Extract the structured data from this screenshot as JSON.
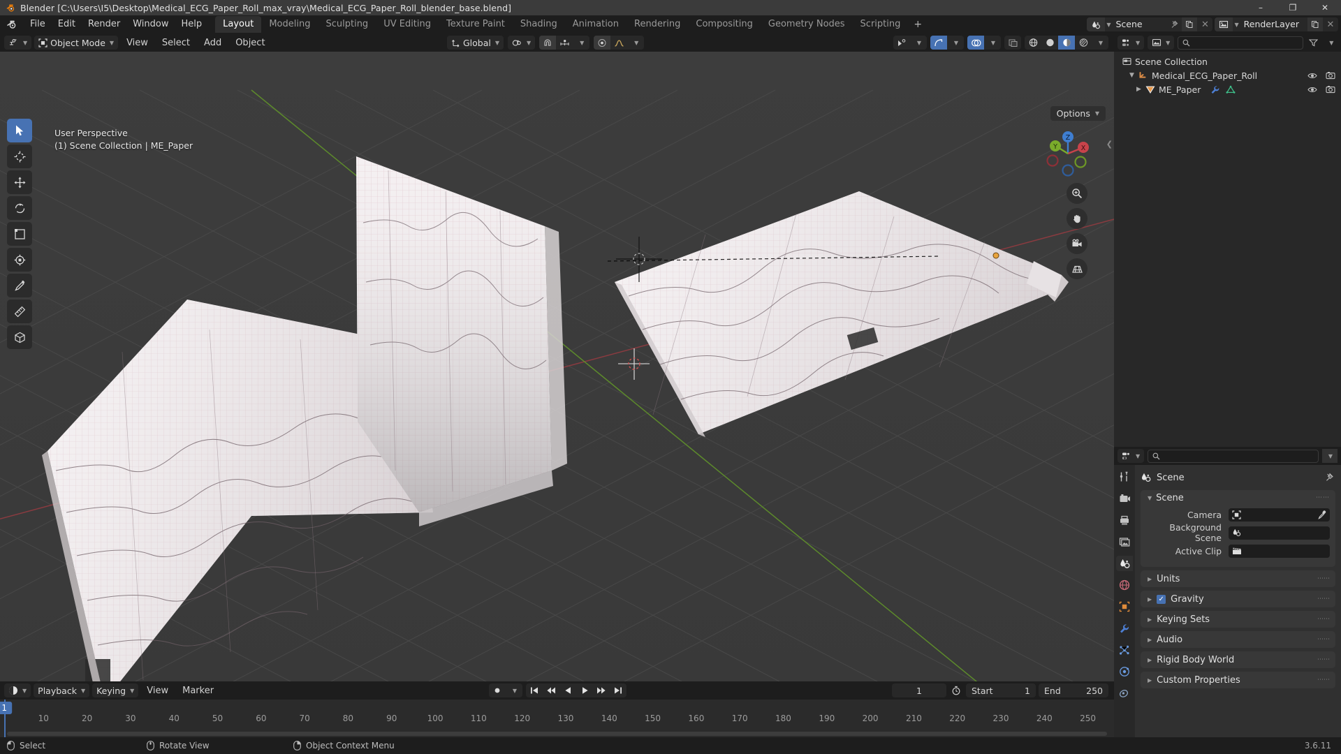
{
  "window": {
    "title": "Blender [C:\\Users\\I5\\Desktop\\Medical_ECG_Paper_Roll_max_vray\\Medical_ECG_Paper_Roll_blender_base.blend]",
    "minimize": "–",
    "maximize": "❐",
    "close": "✕"
  },
  "topbar": {
    "menus": [
      "File",
      "Edit",
      "Render",
      "Window",
      "Help"
    ],
    "workspaces": [
      {
        "label": "Layout",
        "active": true
      },
      {
        "label": "Modeling",
        "active": false
      },
      {
        "label": "Sculpting",
        "active": false
      },
      {
        "label": "UV Editing",
        "active": false
      },
      {
        "label": "Texture Paint",
        "active": false
      },
      {
        "label": "Shading",
        "active": false
      },
      {
        "label": "Animation",
        "active": false
      },
      {
        "label": "Rendering",
        "active": false
      },
      {
        "label": "Compositing",
        "active": false
      },
      {
        "label": "Geometry Nodes",
        "active": false
      },
      {
        "label": "Scripting",
        "active": false
      }
    ],
    "add_workspace": "+",
    "scene_name": "Scene",
    "view_layer_name": "RenderLayer"
  },
  "viewport_header": {
    "editor_type_icon": "editor-type-icon",
    "mode": "Object Mode",
    "menus": [
      "View",
      "Select",
      "Add",
      "Object"
    ],
    "transform_orientation": "Global",
    "snap_icon": "magnet-icon",
    "proportional_icon": "proportional-edit-icon",
    "options_label": "Options"
  },
  "viewport": {
    "perspective_line": "User Perspective",
    "collection_line": "(1) Scene Collection | ME_Paper",
    "gizmo_axes": [
      "Z",
      "Y",
      "X"
    ],
    "tools": [
      {
        "name": "tweak-select-tool",
        "active": true
      },
      {
        "name": "cursor-tool",
        "active": false
      },
      {
        "name": "move-tool",
        "active": false
      },
      {
        "name": "rotate-tool",
        "active": false
      },
      {
        "name": "scale-tool",
        "active": false
      },
      {
        "name": "transform-tool",
        "active": false
      },
      {
        "name": "annotate-tool",
        "active": false
      },
      {
        "name": "measure-tool",
        "active": false
      },
      {
        "name": "add-cube-tool",
        "active": false
      }
    ],
    "nav_buttons": [
      "zoom-icon",
      "pan-hand-icon",
      "camera-view-icon",
      "ortho-persp-icon"
    ]
  },
  "outliner": {
    "display_mode": "view-layer-icon",
    "search_placeholder": "",
    "filter_icon": "filter-icon",
    "rows": [
      {
        "label": "Scene Collection",
        "icon": "collection-icon",
        "indent": 0,
        "expanded": null,
        "eye": false,
        "camera": false
      },
      {
        "label": "Medical_ECG_Paper_Roll",
        "icon": "empty-axes-icon",
        "indent": 1,
        "expanded": true,
        "eye": true,
        "camera": true
      },
      {
        "label": "ME_Paper",
        "icon": "mesh-object-icon",
        "indent": 2,
        "expanded": false,
        "eye": true,
        "camera": true,
        "extras": [
          "wrench-modifier-icon",
          "mesh-data-icon"
        ]
      }
    ]
  },
  "properties": {
    "search_placeholder": "",
    "tabs": [
      {
        "name": "tool-tab",
        "active": false
      },
      {
        "name": "render-tab",
        "active": false
      },
      {
        "name": "output-tab",
        "active": false
      },
      {
        "name": "view-layer-tab",
        "active": false
      },
      {
        "name": "scene-tab",
        "active": true
      },
      {
        "name": "world-tab",
        "active": false
      },
      {
        "name": "object-tab",
        "active": false
      },
      {
        "name": "modifier-tab",
        "active": false
      },
      {
        "name": "particles-tab",
        "active": false
      },
      {
        "name": "physics-tab",
        "active": false
      },
      {
        "name": "constraints-tab",
        "active": false
      }
    ],
    "breadcrumb": "Scene",
    "panel": {
      "title": "Scene",
      "rows": [
        {
          "label": "Camera",
          "value": "",
          "icon": "camera-data-icon",
          "eyedropper": true
        },
        {
          "label": "Background Scene",
          "value": "",
          "icon": "scene-icon",
          "eyedropper": false
        },
        {
          "label": "Active Clip",
          "value": "",
          "icon": "movie-clip-icon",
          "eyedropper": false
        }
      ]
    },
    "closed_panels": [
      {
        "label": "Units",
        "checkbox": null
      },
      {
        "label": "Gravity",
        "checkbox": true
      },
      {
        "label": "Keying Sets",
        "checkbox": null
      },
      {
        "label": "Audio",
        "checkbox": null
      },
      {
        "label": "Rigid Body World",
        "checkbox": null
      },
      {
        "label": "Custom Properties",
        "checkbox": null
      }
    ]
  },
  "timeline": {
    "editor_icon": "timeline-icon",
    "menus": [
      "Playback",
      "Keying",
      "View",
      "Marker"
    ],
    "current_frame": "1",
    "start_label": "Start",
    "start_value": "1",
    "end_label": "End",
    "end_value": "250",
    "ticks": [
      "10",
      "20",
      "30",
      "40",
      "50",
      "60",
      "70",
      "80",
      "90",
      "100",
      "110",
      "120",
      "130",
      "140",
      "150",
      "160",
      "170",
      "180",
      "190",
      "200",
      "210",
      "220",
      "230",
      "240",
      "250"
    ],
    "tick_values": [
      10,
      20,
      30,
      40,
      50,
      60,
      70,
      80,
      90,
      100,
      110,
      120,
      130,
      140,
      150,
      160,
      170,
      180,
      190,
      200,
      210,
      220,
      230,
      240,
      250
    ],
    "playhead_frame": 1,
    "range_min": 0,
    "range_max": 256
  },
  "status": {
    "items": [
      {
        "icon": "mouse-left-icon",
        "label": "Select"
      },
      {
        "icon": "mouse-middle-icon",
        "label": "Rotate View"
      },
      {
        "icon": "mouse-right-icon",
        "label": "Object Context Menu"
      }
    ],
    "version": "3.6.11"
  },
  "colors": {
    "accent": "#4772b3",
    "header_bg": "#1d1d1d",
    "panel_bg": "#303030",
    "viewport_bg": "#3b3b3b",
    "axis_x": "#9b3b40",
    "axis_y": "#5c8c28",
    "title_bg": "#3b3b3b"
  }
}
